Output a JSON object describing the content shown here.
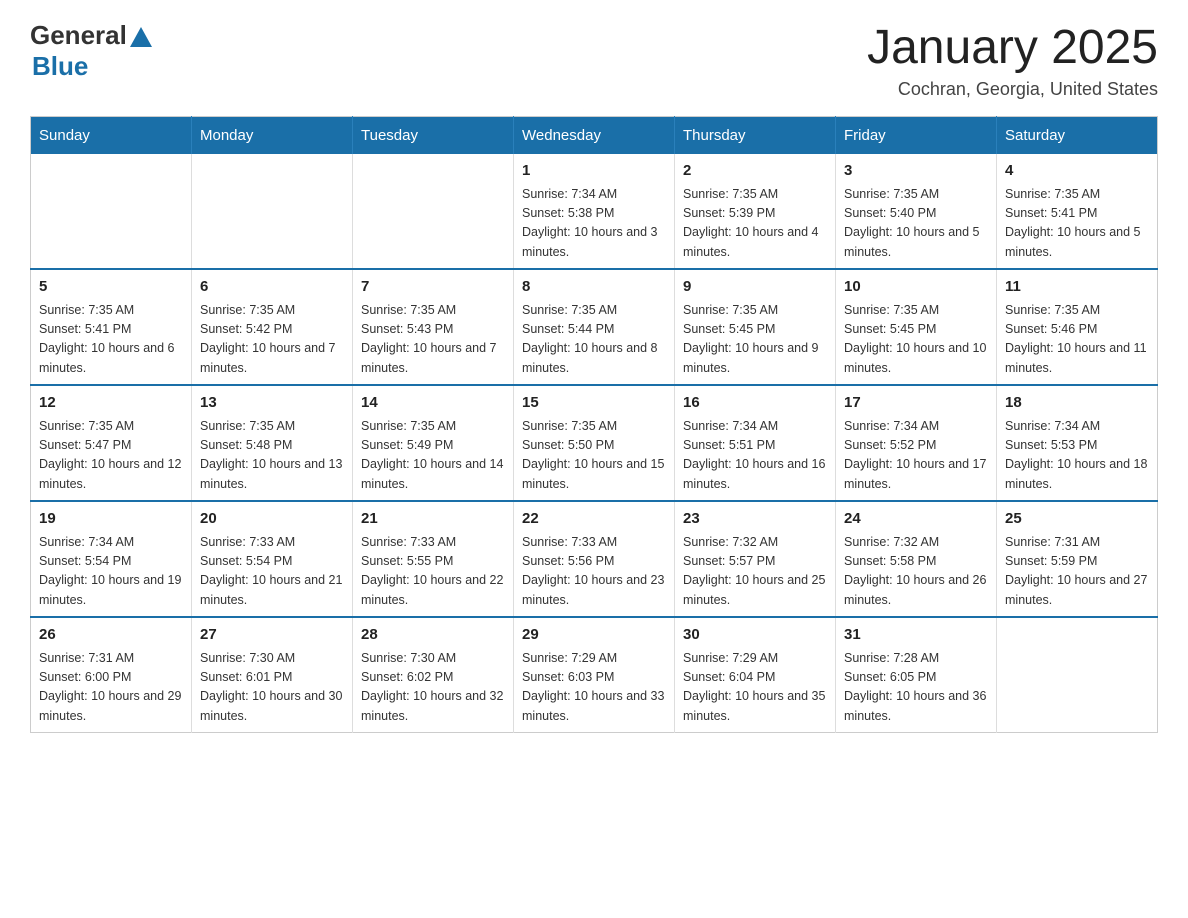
{
  "header": {
    "title": "January 2025",
    "subtitle": "Cochran, Georgia, United States",
    "logo_general": "General",
    "logo_blue": "Blue"
  },
  "weekdays": [
    "Sunday",
    "Monday",
    "Tuesday",
    "Wednesday",
    "Thursday",
    "Friday",
    "Saturday"
  ],
  "weeks": [
    [
      {
        "day": "",
        "info": ""
      },
      {
        "day": "",
        "info": ""
      },
      {
        "day": "",
        "info": ""
      },
      {
        "day": "1",
        "info": "Sunrise: 7:34 AM\nSunset: 5:38 PM\nDaylight: 10 hours and 3 minutes."
      },
      {
        "day": "2",
        "info": "Sunrise: 7:35 AM\nSunset: 5:39 PM\nDaylight: 10 hours and 4 minutes."
      },
      {
        "day": "3",
        "info": "Sunrise: 7:35 AM\nSunset: 5:40 PM\nDaylight: 10 hours and 5 minutes."
      },
      {
        "day": "4",
        "info": "Sunrise: 7:35 AM\nSunset: 5:41 PM\nDaylight: 10 hours and 5 minutes."
      }
    ],
    [
      {
        "day": "5",
        "info": "Sunrise: 7:35 AM\nSunset: 5:41 PM\nDaylight: 10 hours and 6 minutes."
      },
      {
        "day": "6",
        "info": "Sunrise: 7:35 AM\nSunset: 5:42 PM\nDaylight: 10 hours and 7 minutes."
      },
      {
        "day": "7",
        "info": "Sunrise: 7:35 AM\nSunset: 5:43 PM\nDaylight: 10 hours and 7 minutes."
      },
      {
        "day": "8",
        "info": "Sunrise: 7:35 AM\nSunset: 5:44 PM\nDaylight: 10 hours and 8 minutes."
      },
      {
        "day": "9",
        "info": "Sunrise: 7:35 AM\nSunset: 5:45 PM\nDaylight: 10 hours and 9 minutes."
      },
      {
        "day": "10",
        "info": "Sunrise: 7:35 AM\nSunset: 5:45 PM\nDaylight: 10 hours and 10 minutes."
      },
      {
        "day": "11",
        "info": "Sunrise: 7:35 AM\nSunset: 5:46 PM\nDaylight: 10 hours and 11 minutes."
      }
    ],
    [
      {
        "day": "12",
        "info": "Sunrise: 7:35 AM\nSunset: 5:47 PM\nDaylight: 10 hours and 12 minutes."
      },
      {
        "day": "13",
        "info": "Sunrise: 7:35 AM\nSunset: 5:48 PM\nDaylight: 10 hours and 13 minutes."
      },
      {
        "day": "14",
        "info": "Sunrise: 7:35 AM\nSunset: 5:49 PM\nDaylight: 10 hours and 14 minutes."
      },
      {
        "day": "15",
        "info": "Sunrise: 7:35 AM\nSunset: 5:50 PM\nDaylight: 10 hours and 15 minutes."
      },
      {
        "day": "16",
        "info": "Sunrise: 7:34 AM\nSunset: 5:51 PM\nDaylight: 10 hours and 16 minutes."
      },
      {
        "day": "17",
        "info": "Sunrise: 7:34 AM\nSunset: 5:52 PM\nDaylight: 10 hours and 17 minutes."
      },
      {
        "day": "18",
        "info": "Sunrise: 7:34 AM\nSunset: 5:53 PM\nDaylight: 10 hours and 18 minutes."
      }
    ],
    [
      {
        "day": "19",
        "info": "Sunrise: 7:34 AM\nSunset: 5:54 PM\nDaylight: 10 hours and 19 minutes."
      },
      {
        "day": "20",
        "info": "Sunrise: 7:33 AM\nSunset: 5:54 PM\nDaylight: 10 hours and 21 minutes."
      },
      {
        "day": "21",
        "info": "Sunrise: 7:33 AM\nSunset: 5:55 PM\nDaylight: 10 hours and 22 minutes."
      },
      {
        "day": "22",
        "info": "Sunrise: 7:33 AM\nSunset: 5:56 PM\nDaylight: 10 hours and 23 minutes."
      },
      {
        "day": "23",
        "info": "Sunrise: 7:32 AM\nSunset: 5:57 PM\nDaylight: 10 hours and 25 minutes."
      },
      {
        "day": "24",
        "info": "Sunrise: 7:32 AM\nSunset: 5:58 PM\nDaylight: 10 hours and 26 minutes."
      },
      {
        "day": "25",
        "info": "Sunrise: 7:31 AM\nSunset: 5:59 PM\nDaylight: 10 hours and 27 minutes."
      }
    ],
    [
      {
        "day": "26",
        "info": "Sunrise: 7:31 AM\nSunset: 6:00 PM\nDaylight: 10 hours and 29 minutes."
      },
      {
        "day": "27",
        "info": "Sunrise: 7:30 AM\nSunset: 6:01 PM\nDaylight: 10 hours and 30 minutes."
      },
      {
        "day": "28",
        "info": "Sunrise: 7:30 AM\nSunset: 6:02 PM\nDaylight: 10 hours and 32 minutes."
      },
      {
        "day": "29",
        "info": "Sunrise: 7:29 AM\nSunset: 6:03 PM\nDaylight: 10 hours and 33 minutes."
      },
      {
        "day": "30",
        "info": "Sunrise: 7:29 AM\nSunset: 6:04 PM\nDaylight: 10 hours and 35 minutes."
      },
      {
        "day": "31",
        "info": "Sunrise: 7:28 AM\nSunset: 6:05 PM\nDaylight: 10 hours and 36 minutes."
      },
      {
        "day": "",
        "info": ""
      }
    ]
  ]
}
